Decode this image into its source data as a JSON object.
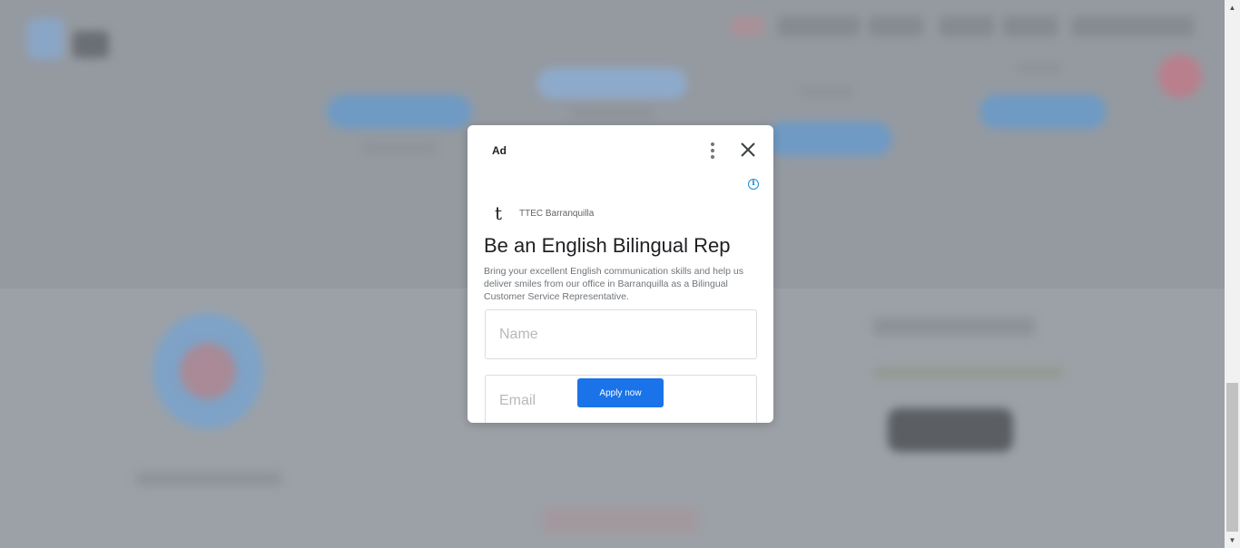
{
  "ad": {
    "label": "Ad",
    "advertiser": "TTEC Barranquilla",
    "advertiser_logo": "t",
    "headline": "Be an English Bilingual Rep",
    "description": "Bring your excellent English communication skills and help us deliver smiles from our office in Barranquilla as a Bilingual Customer Service Representative.",
    "form": {
      "name_placeholder": "Name",
      "email_placeholder": "Email"
    },
    "cta_label": "Apply now",
    "info_symbol": "i"
  },
  "icons": {
    "menu": "more-vert-icon",
    "close": "close-icon",
    "info": "info-icon",
    "scroll_up": "arrow-up-icon",
    "scroll_down": "arrow-down-icon"
  },
  "colors": {
    "overlay": "#9ba0a6",
    "cta": "#1a73e8",
    "info": "#1a8ccf"
  }
}
